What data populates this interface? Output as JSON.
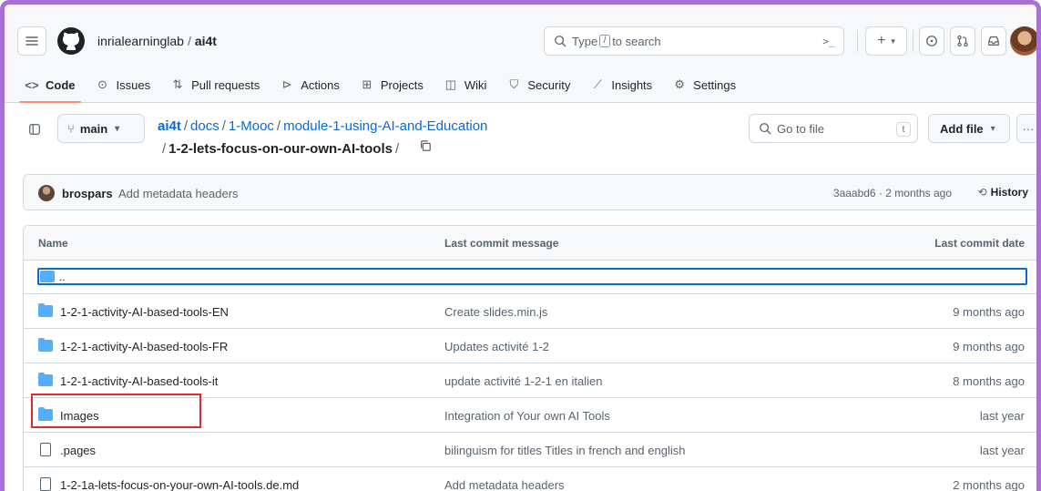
{
  "header": {
    "owner": "inrialearninglab",
    "separator": "/",
    "repo": "ai4t",
    "search_placeholder_pre": "Type",
    "search_key": "/",
    "search_placeholder_post": "to search",
    "command_icon": "terminal-icon",
    "buttons": [
      "plus-icon",
      "issue-icon",
      "pull-request-icon",
      "inbox-icon"
    ]
  },
  "nav": {
    "items": [
      {
        "icon": "code-icon",
        "label": "Code",
        "active": true
      },
      {
        "icon": "issue-icon",
        "label": "Issues"
      },
      {
        "icon": "pull-request-icon",
        "label": "Pull requests"
      },
      {
        "icon": "play-icon",
        "label": "Actions"
      },
      {
        "icon": "table-icon",
        "label": "Projects"
      },
      {
        "icon": "book-icon",
        "label": "Wiki"
      },
      {
        "icon": "shield-icon",
        "label": "Security"
      },
      {
        "icon": "graph-icon",
        "label": "Insights"
      },
      {
        "icon": "gear-icon",
        "label": "Settings"
      }
    ]
  },
  "pathbar": {
    "branch": "main",
    "repo": "ai4t",
    "seg1": "docs",
    "seg2": "1-Mooc",
    "seg3": "module-1-using-AI-and-Education",
    "current": "1-2-lets-focus-on-our-own-AI-tools",
    "goto_placeholder": "Go to file",
    "goto_key": "t",
    "add_file": "Add file"
  },
  "commit": {
    "author": "brospars",
    "message": "Add metadata headers",
    "meta": "3aaabd6 · 2 months ago",
    "history": "History"
  },
  "table": {
    "columns": {
      "name": "Name",
      "message": "Last commit message",
      "date": "Last commit date"
    },
    "parent": "..",
    "rows": [
      {
        "type": "folder",
        "name": "1-2-1-activity-AI-based-tools-EN",
        "message": "Create slides.min.js",
        "date": "9 months ago"
      },
      {
        "type": "folder",
        "name": "1-2-1-activity-AI-based-tools-FR",
        "message": "Updates activité 1-2",
        "date": "9 months ago"
      },
      {
        "type": "folder",
        "name": "1-2-1-activity-AI-based-tools-it",
        "message": "update activité 1-2-1 en italien",
        "date": "8 months ago"
      },
      {
        "type": "folder",
        "name": "Images",
        "message": "Integration of Your own AI Tools",
        "date": "last year"
      },
      {
        "type": "file",
        "name": ".pages",
        "message": "bilinguism for titles Titles in french and english",
        "date": "last year"
      },
      {
        "type": "file",
        "name": "1-2-1a-lets-focus-on-your-own-AI-tools.de.md",
        "message": "Add metadata headers",
        "date": "2 months ago"
      }
    ]
  },
  "colors": {
    "accent": "#0969da",
    "highlight": "#e02b2b",
    "folder": "#54aeff",
    "frame": "#a970d6",
    "tab_underline": "#fd8c73"
  }
}
